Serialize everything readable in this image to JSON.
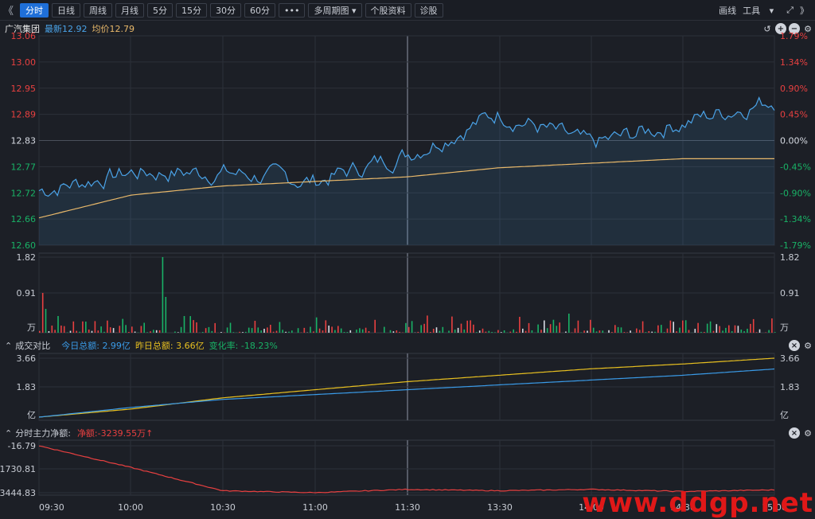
{
  "toolbar": {
    "left_arrow": "《",
    "tabs": [
      {
        "label": "分时",
        "active": true
      },
      {
        "label": "日线"
      },
      {
        "label": "周线"
      },
      {
        "label": "月线"
      },
      {
        "label": "5分"
      },
      {
        "label": "15分"
      },
      {
        "label": "30分"
      },
      {
        "label": "60分"
      },
      {
        "label": "•••"
      }
    ],
    "multi_period": "多周期图",
    "stock_info": "个股资料",
    "diagnose": "诊股",
    "draw": "画线",
    "tools": "工具",
    "right_arrow": "》"
  },
  "header": {
    "stock_name": "广汽集团",
    "latest_label": "最新",
    "latest_value": "12.92",
    "avg_label": "均价",
    "avg_value": "12.79"
  },
  "price_axis": {
    "left": [
      "13.06",
      "13.00",
      "12.95",
      "12.89",
      "12.83",
      "12.77",
      "12.72",
      "12.66",
      "12.60"
    ],
    "right": [
      "1.79%",
      "1.34%",
      "0.90%",
      "0.45%",
      "0.00%",
      "-0.45%",
      "-0.90%",
      "-1.34%",
      "-1.79%"
    ]
  },
  "volume_axis": {
    "left": [
      "1.82",
      "0.91",
      "万"
    ],
    "right": [
      "1.82",
      "0.91",
      "万"
    ]
  },
  "turnover": {
    "title": "成交对比",
    "today_label": "今日总额:",
    "today_value": "2.99亿",
    "yesterday_label": "昨日总额:",
    "yesterday_value": "3.66亿",
    "change_label": "变化率:",
    "change_value": "-18.23%",
    "axis_left": [
      "3.66",
      "1.83",
      "亿"
    ],
    "axis_right": [
      "3.66",
      "1.83",
      "亿"
    ]
  },
  "mainflow": {
    "title": "分时主力净额:",
    "net_label": "净额:",
    "net_value": "-3239.55万",
    "arrow": "↑",
    "axis": [
      "-16.79",
      "-1730.81",
      "-3444.83"
    ]
  },
  "time_axis": [
    "09:30",
    "10:00",
    "10:30",
    "11:00",
    "11:30",
    "13:30",
    "14:00",
    "14:30",
    "15:00"
  ],
  "watermark": "www.ddgp.net",
  "colors": {
    "up": "#e84040",
    "down": "#19b266",
    "price_line": "#4aa3e8",
    "avg_line": "#e8b86a",
    "today_line": "#3a9be8",
    "yesterday_line": "#e8c020",
    "accent": "#1f6fd8"
  },
  "chart_data": [
    {
      "type": "line",
      "name": "price",
      "ylim": [
        12.6,
        13.06
      ],
      "x": [
        "09:30",
        "10:00",
        "10:30",
        "11:00",
        "11:30",
        "13:30",
        "14:00",
        "14:30",
        "15:00"
      ],
      "series": [
        {
          "values": [
            12.72,
            12.76,
            12.76,
            12.74,
            12.8,
            12.89,
            12.82,
            12.87,
            12.92
          ]
        },
        {
          "values": [
            12.66,
            12.71,
            12.73,
            12.74,
            12.75,
            12.77,
            12.78,
            12.79,
            12.79
          ]
        }
      ],
      "xlabel": "",
      "ylabel": ""
    },
    {
      "type": "line",
      "name": "turnover",
      "ylim": [
        0,
        3.66
      ],
      "series": [
        {
          "name": "今日总额",
          "values": [
            0,
            0.6,
            1.1,
            1.4,
            1.7,
            2.0,
            2.3,
            2.6,
            2.99
          ]
        },
        {
          "name": "昨日总额",
          "values": [
            0,
            0.5,
            1.2,
            1.7,
            2.2,
            2.6,
            3.0,
            3.3,
            3.66
          ]
        }
      ]
    },
    {
      "type": "line",
      "name": "mainflow",
      "ylim": [
        -3444.83,
        -16.79
      ],
      "series": [
        {
          "values": [
            -16.79,
            -1600,
            -3300,
            -3440,
            -3200,
            -3300,
            -3200,
            -3350,
            -3239.55
          ]
        }
      ]
    }
  ]
}
